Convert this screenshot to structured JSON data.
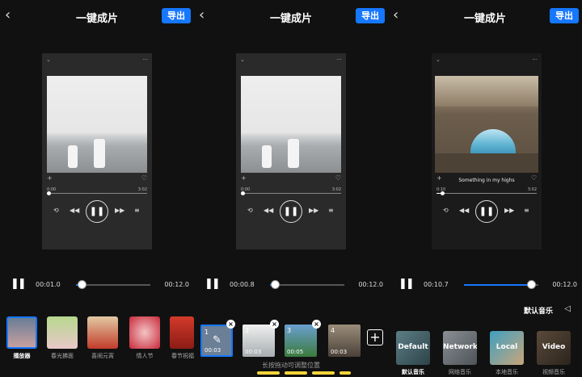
{
  "header": {
    "title": "一键成片",
    "export_label": "导出"
  },
  "screens": [
    {
      "player": {
        "time_start": "0:00",
        "time_end": "3:02",
        "progress": 0.02
      },
      "timeline": {
        "current": "00:01.0",
        "total": "00:12.0",
        "progress": 0.08
      },
      "templates": [
        {
          "label": "播放器",
          "selected": true
        },
        {
          "label": "春光拂面"
        },
        {
          "label": "喜闹元宵"
        },
        {
          "label": "情人节"
        },
        {
          "label": "春节祝福"
        }
      ]
    },
    {
      "player": {
        "time_start": "0:00",
        "time_end": "3:02",
        "progress": 0.02
      },
      "timeline": {
        "current": "00:00.8",
        "total": "00:12.0",
        "progress": 0.07
      },
      "clips": [
        {
          "number": "1",
          "duration": "00:03"
        },
        {
          "number": "2",
          "duration": "00:03"
        },
        {
          "number": "3",
          "duration": "00:05"
        },
        {
          "number": "4",
          "duration": "00:03"
        }
      ],
      "hint": "长按拖动可调整位置"
    },
    {
      "player": {
        "song": "Something in my highs",
        "time_start": "0:10",
        "time_end": "3:02",
        "progress": 0.06
      },
      "timeline": {
        "current": "00:10.7",
        "total": "00:12.0",
        "progress": 0.9
      },
      "music_header": "默认音乐",
      "music": [
        {
          "tile_text": "Default",
          "label": "默认音乐",
          "selected": true
        },
        {
          "tile_text": "Network",
          "label": "网络音乐"
        },
        {
          "tile_text": "Local",
          "label": "本地音乐"
        },
        {
          "tile_text": "Video",
          "label": "视频音乐"
        }
      ]
    }
  ],
  "icons": {
    "back": "‹",
    "pause": "❚❚",
    "add": "+",
    "heart": "♡",
    "repeat": "⟲",
    "prev": "◀◀",
    "next": "▶▶",
    "playlist": "≡",
    "close": "×",
    "speaker": "◁",
    "more": "···",
    "collapse": "⌄"
  },
  "colors": {
    "accent": "#1677ff",
    "highlight": "#f5d438"
  }
}
